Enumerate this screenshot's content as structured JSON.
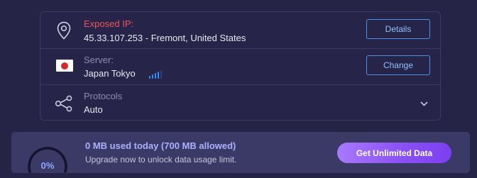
{
  "connection": {
    "ip": {
      "label": "Exposed IP:",
      "value": "45.33.107.253 - Fremont, United States",
      "icon": "location-pin-icon",
      "button_label": "Details"
    },
    "server": {
      "label": "Server:",
      "value": "Japan Tokyo",
      "flag": "japan-flag-icon",
      "signal_bars": 4,
      "button_label": "Change"
    },
    "protocols": {
      "label": "Protocols",
      "value": "Auto",
      "icon": "share-nodes-icon",
      "dropdown_icon": "chevron-down-icon"
    }
  },
  "usage": {
    "percent_label": "0%",
    "percent": 0,
    "title": "0 MB used today (700 MB allowed)",
    "subtitle": "Upgrade now to unlock data usage limit.",
    "cta_label": "Get Unlimited Data"
  },
  "colors": {
    "background": "#252447",
    "alert_red": "#f0555b",
    "accent_blue": "#4a92e6",
    "cta_purple": "#8b52f4"
  }
}
